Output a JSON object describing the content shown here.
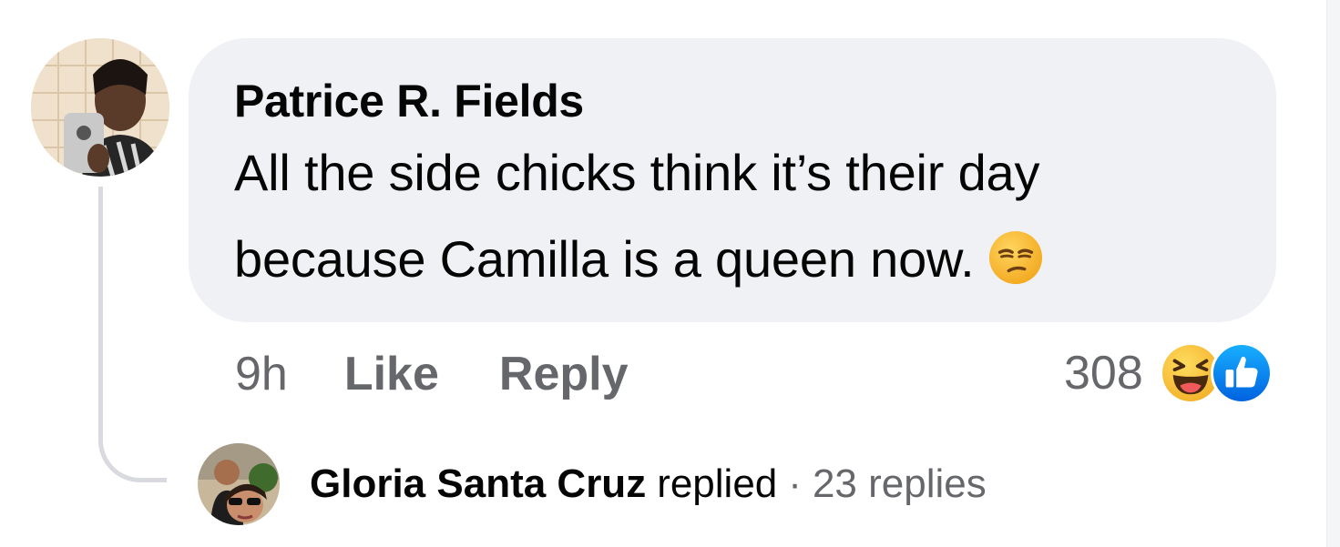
{
  "comment": {
    "author": "Patrice R. Fields",
    "text": "All the side chicks think it’s their day because Camilla is a queen now.",
    "emoji": "unamused-face",
    "time": "9h",
    "like_label": "Like",
    "reply_label": "Reply",
    "reaction_count": "308",
    "reactions": [
      "laughing-face",
      "thumbs-up"
    ]
  },
  "reply_summary": {
    "name": "Gloria Santa Cruz",
    "verb": "replied",
    "separator": "·",
    "count": "23 replies"
  },
  "colors": {
    "bubble": "#eff1f4",
    "text": "#050505",
    "secondary_text": "#65676b",
    "like_blue": "#1877f2",
    "emoji_yellow": "#f7c33b"
  }
}
